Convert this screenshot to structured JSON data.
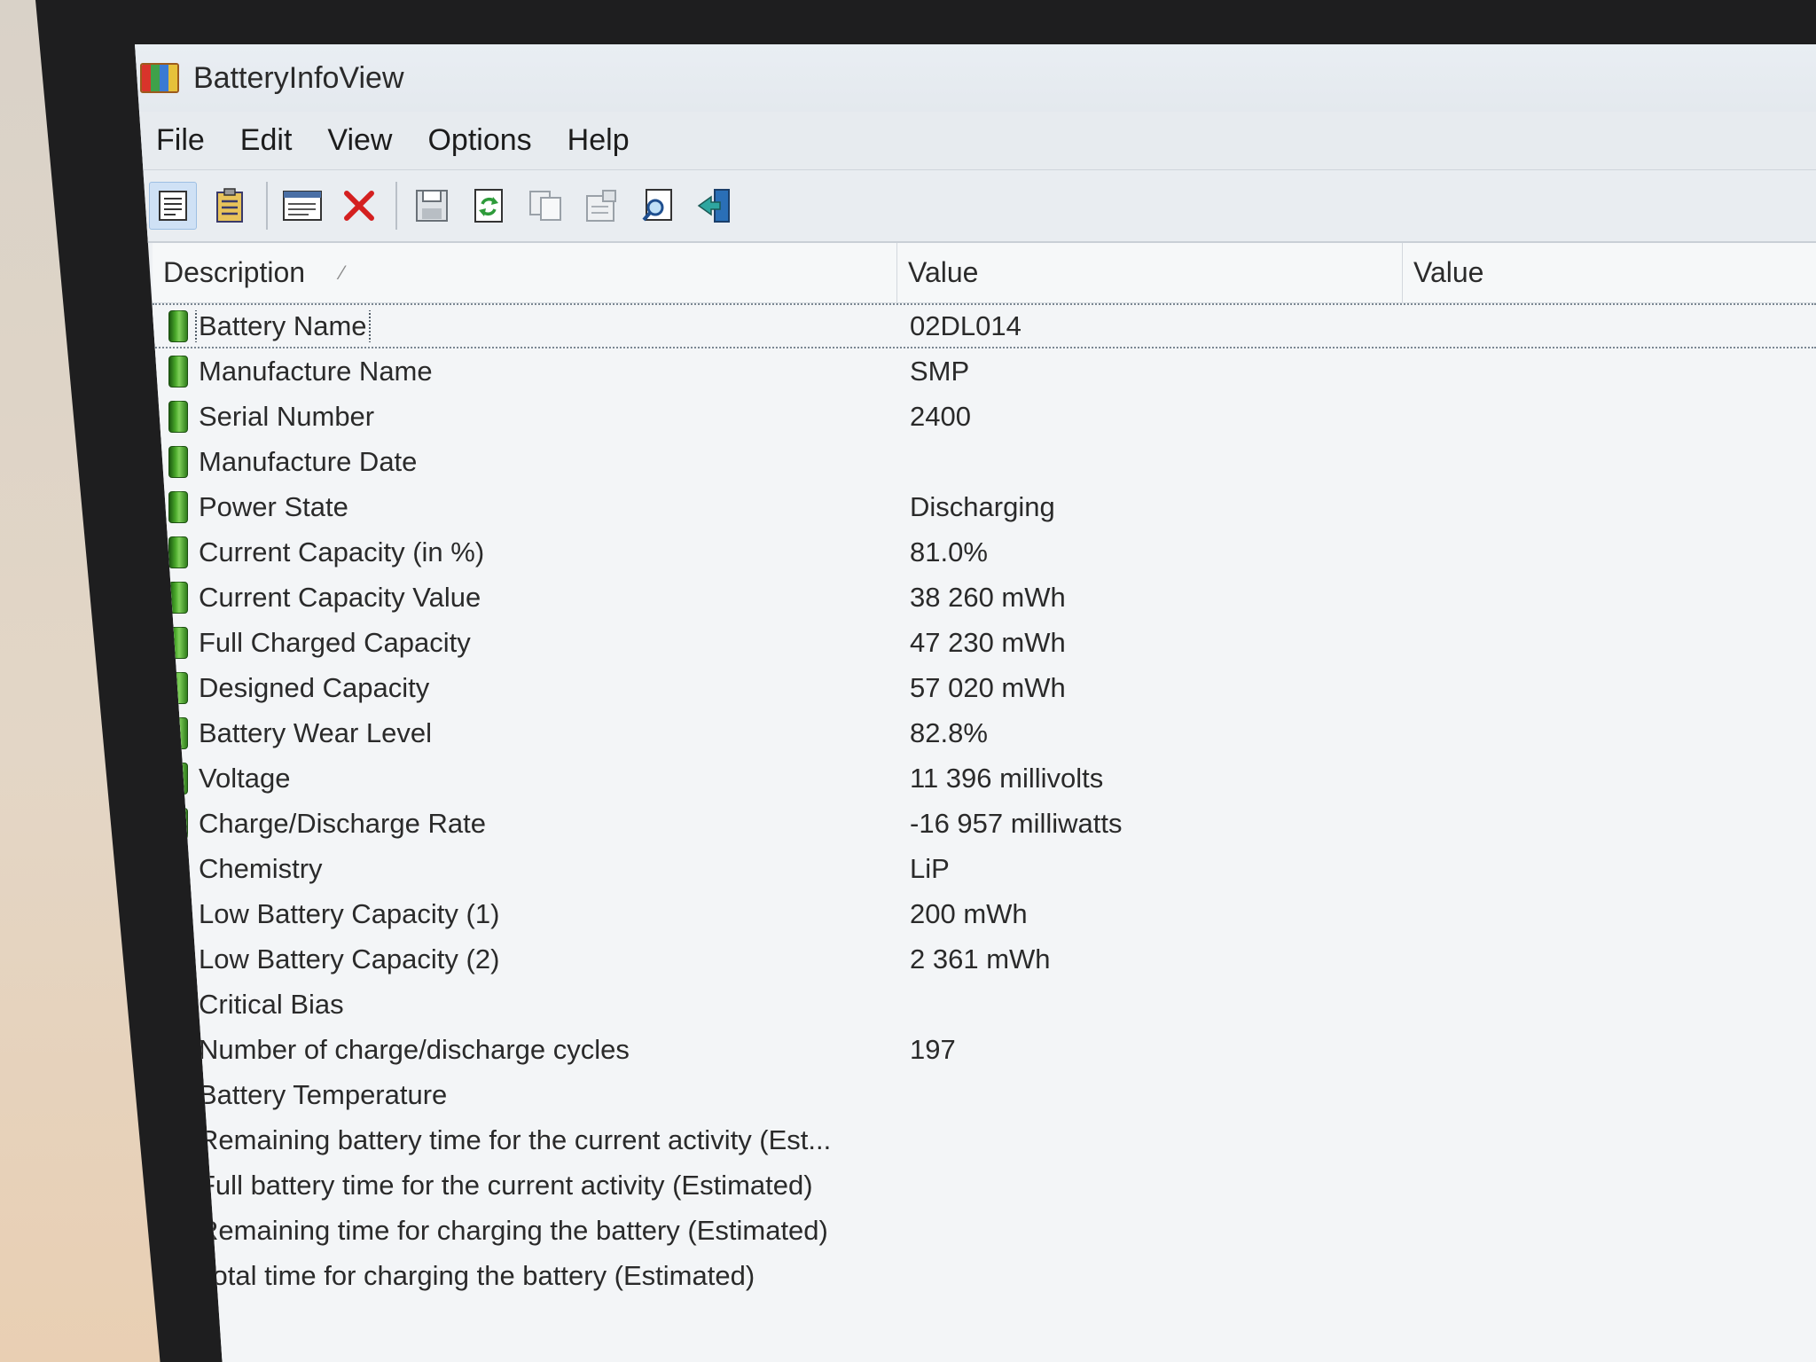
{
  "window": {
    "title": "BatteryInfoView",
    "icon": "battery-app-icon"
  },
  "menu": [
    "File",
    "Edit",
    "View",
    "Options",
    "Help"
  ],
  "toolbar": [
    {
      "name": "properties-list-icon"
    },
    {
      "name": "summary-list-icon"
    },
    {
      "name": "html-report-icon"
    },
    {
      "name": "delete-icon"
    },
    {
      "name": "save-icon"
    },
    {
      "name": "refresh-icon"
    },
    {
      "name": "copy-icon"
    },
    {
      "name": "properties-icon"
    },
    {
      "name": "find-icon"
    },
    {
      "name": "exit-icon"
    }
  ],
  "columns": {
    "description": "Description",
    "value1": "Value",
    "value2": "Value"
  },
  "rows": [
    {
      "label": "Battery Name",
      "value": "02DL014"
    },
    {
      "label": "Manufacture Name",
      "value": "SMP"
    },
    {
      "label": "Serial Number",
      "value": " 2400"
    },
    {
      "label": "Manufacture Date",
      "value": ""
    },
    {
      "label": "Power State",
      "value": "Discharging"
    },
    {
      "label": "Current Capacity (in %)",
      "value": "81.0%"
    },
    {
      "label": "Current Capacity Value",
      "value": "38 260 mWh"
    },
    {
      "label": "Full Charged Capacity",
      "value": "47 230 mWh"
    },
    {
      "label": "Designed Capacity",
      "value": "57 020 mWh"
    },
    {
      "label": "Battery Wear Level",
      "value": "82.8%"
    },
    {
      "label": "Voltage",
      "value": "11 396 millivolts"
    },
    {
      "label": "Charge/Discharge Rate",
      "value": "-16 957 milliwatts"
    },
    {
      "label": "Chemistry",
      "value": "LiP"
    },
    {
      "label": "Low Battery Capacity (1)",
      "value": "200 mWh"
    },
    {
      "label": "Low Battery Capacity (2)",
      "value": "2 361 mWh"
    },
    {
      "label": "Critical Bias",
      "value": ""
    },
    {
      "label": "Number of charge/discharge cycles",
      "value": "197"
    },
    {
      "label": "Battery Temperature",
      "value": ""
    },
    {
      "label": "Remaining battery time for the current activity (Est...",
      "value": ""
    },
    {
      "label": "Full battery time for the current activity (Estimated)",
      "value": ""
    },
    {
      "label": "Remaining time for charging the battery (Estimated)",
      "value": ""
    },
    {
      "label": "Total  time for charging the battery (Estimated)",
      "value": ""
    }
  ]
}
